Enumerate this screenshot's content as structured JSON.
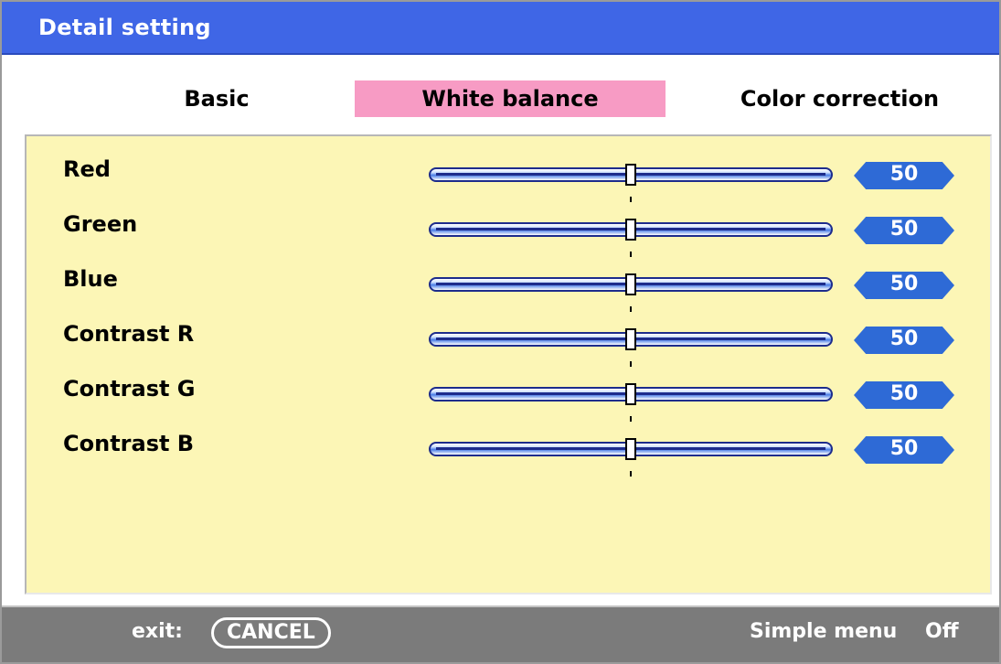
{
  "window": {
    "title": "Detail setting"
  },
  "tabs": [
    {
      "label": "Basic",
      "active": false
    },
    {
      "label": "White balance",
      "active": true
    },
    {
      "label": "Color correction",
      "active": false
    }
  ],
  "settings": [
    {
      "label": "Red",
      "value": "50"
    },
    {
      "label": "Green",
      "value": "50"
    },
    {
      "label": "Blue",
      "value": "50"
    },
    {
      "label": "Contrast R",
      "value": "50"
    },
    {
      "label": "Contrast G",
      "value": "50"
    },
    {
      "label": "Contrast B",
      "value": "50"
    }
  ],
  "slider": {
    "min": 0,
    "max": 100
  },
  "footer": {
    "exit_label": "exit:",
    "cancel_label": "CANCEL",
    "simple_menu_label": "Simple menu",
    "simple_menu_value": "Off"
  },
  "colors": {
    "titlebar": "#3f66e6",
    "active_tab": "#f79bc4",
    "panel": "#fcf6b6",
    "value_box": "#2e6ad6",
    "footer": "#7b7b7b"
  }
}
